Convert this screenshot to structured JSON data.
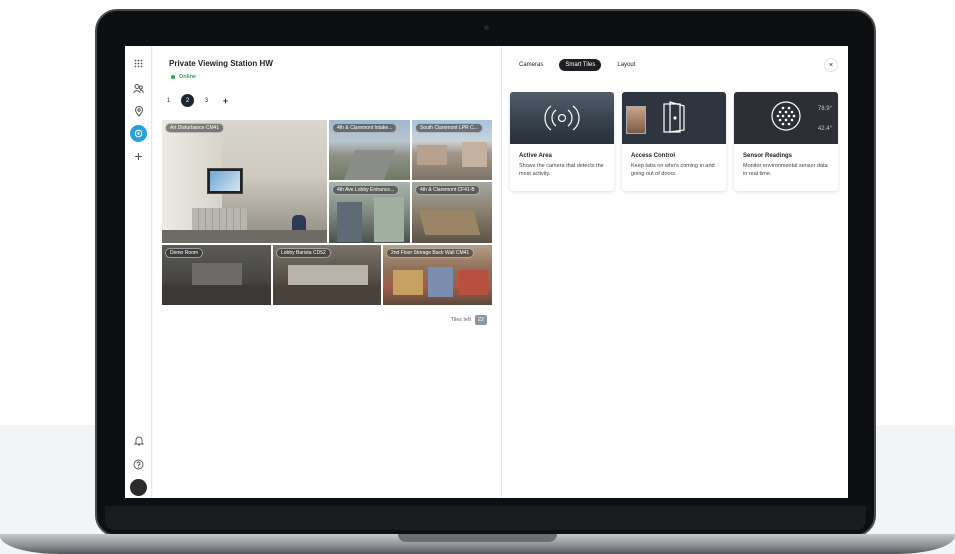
{
  "app": {
    "title": "Private Viewing Station HW",
    "status": "Online"
  },
  "pages": [
    "1",
    "2",
    "3",
    "+"
  ],
  "tiles": [
    {
      "label": "Art Disturbance CM41"
    },
    {
      "label": "4th & Claremont Intake..."
    },
    {
      "label": "South Claremont LPR C..."
    },
    {
      "label": "4th Ave Lobby Entrance..."
    },
    {
      "label": "4th & Claremont CF41-B"
    },
    {
      "label": "Demo Room"
    },
    {
      "label": "Lobby Barista CD52"
    },
    {
      "label": "2nd Floor Storage Back Wall CM41"
    }
  ],
  "tiles_left": {
    "label": "Tiles left",
    "count": "22"
  },
  "right_panel": {
    "tabs": [
      "Cameras",
      "Smart Tiles",
      "Layout"
    ],
    "active_tab": "Smart Tiles",
    "close_icon": "×"
  },
  "smart_tiles": [
    {
      "title": "Active Area",
      "description": "Shows the camera that detects the most activity."
    },
    {
      "title": "Access Control",
      "description": "Keep tabs on who's coming in and going out of doors."
    },
    {
      "title": "Sensor Readings",
      "description": "Monitor environmental sensor data in real time.",
      "reading_high": "78.9°",
      "reading_low": "42.4°"
    }
  ],
  "colors": {
    "accent": "#2a9fd8",
    "online": "#2fa653",
    "tab_active_bg": "#1c1e22"
  },
  "icons": {
    "sidebar": [
      "apps-grid-icon",
      "people-icon",
      "location-pin-icon",
      "cameras-icon",
      "plus-icon",
      "bell-icon",
      "help-icon"
    ]
  }
}
